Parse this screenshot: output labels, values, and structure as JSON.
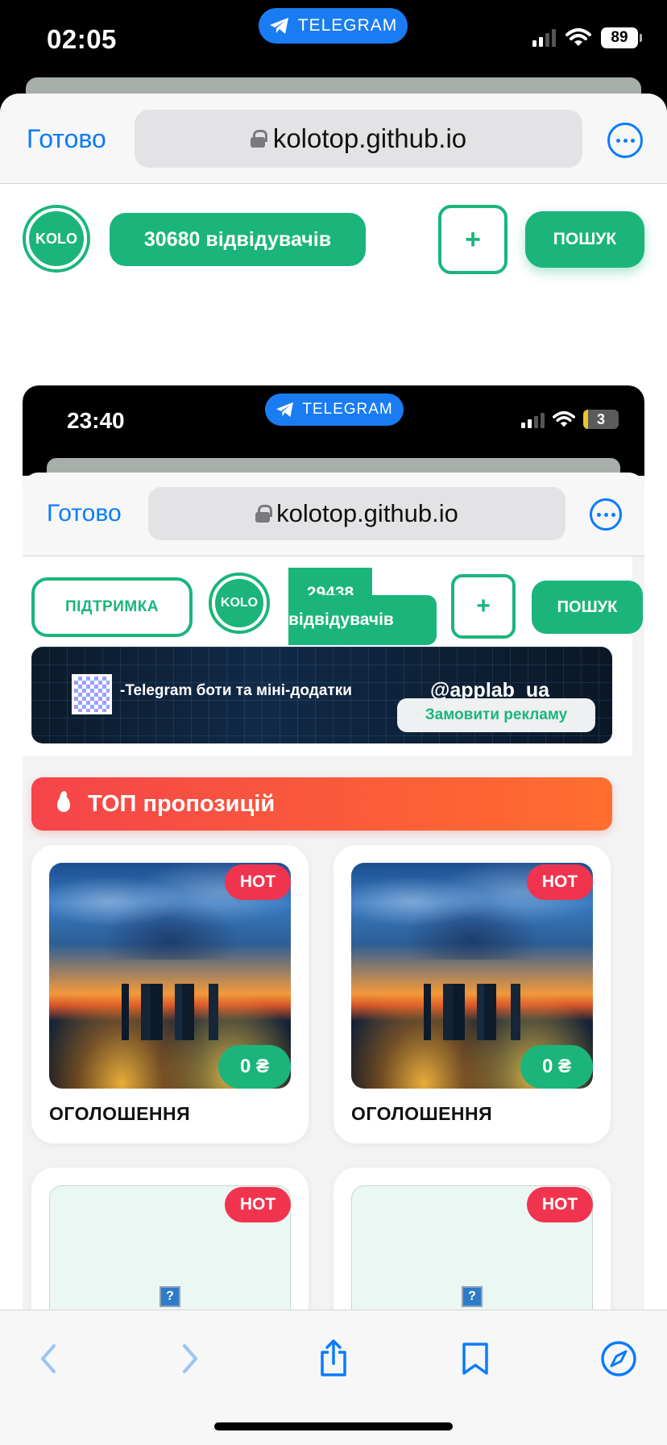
{
  "status_bar": {
    "time": "02:05",
    "telegram_label": "TELEGRAM",
    "battery": "89"
  },
  "safari": {
    "done_label": "Готово",
    "url": "kolotop.github.io"
  },
  "header": {
    "logo_text": "KOLO",
    "visitors": "30680 відвідувачів",
    "add_label": "+",
    "search_label": "ПОШУК"
  },
  "inner": {
    "status_bar": {
      "time": "23:40",
      "telegram_label": "TELEGRAM",
      "battery": "3"
    },
    "safari": {
      "done_label": "Готово",
      "url": "kolotop.github.io"
    },
    "header": {
      "support_label": "ПІДТРИМКА",
      "logo_text": "KOLO",
      "visitors_line1": "29438",
      "visitors_line2": "відвідувачів",
      "add_label": "+",
      "search_label": "ПОШУК"
    },
    "banner": {
      "text": "-Telegram боти та міні-додатки",
      "handle": "@applab_ua",
      "order_ad_label": "Замовити рекламу"
    },
    "top_offers_title": "ТОП пропозицій",
    "cards": [
      {
        "badge": "HOT",
        "price": "0 ₴",
        "title": "ОГОЛОШЕННЯ"
      },
      {
        "badge": "HOT",
        "price": "0 ₴",
        "title": "ОГОЛОШЕННЯ"
      },
      {
        "badge": "HOT",
        "broken_image_glyph": "?"
      },
      {
        "badge": "HOT",
        "broken_image_glyph": "?"
      }
    ]
  },
  "toolbar": {
    "icons": [
      "back-icon",
      "forward-icon",
      "share-icon",
      "bookmarks-icon",
      "compass-icon"
    ]
  },
  "colors": {
    "brand_green": "#1bb57c",
    "safari_blue": "#0a7bff",
    "hot_red": "#f0344f",
    "offers_gradient_start": "#f5444a",
    "offers_gradient_end": "#ff6e2e",
    "telegram_blue": "#1a7cf2"
  }
}
